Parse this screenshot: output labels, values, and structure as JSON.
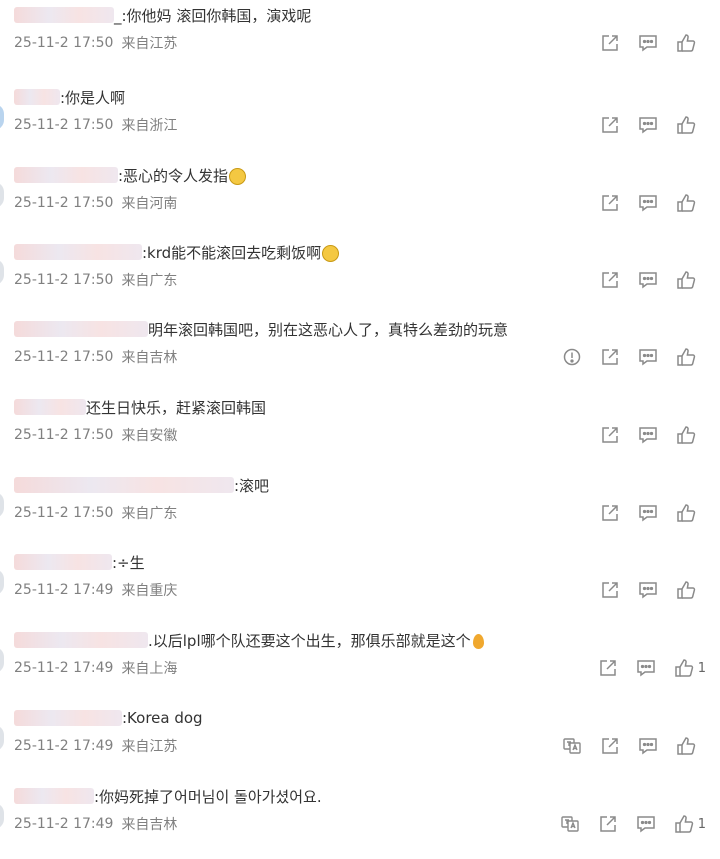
{
  "colors": {
    "text": "#333333",
    "meta": "#808080",
    "icon": "#8a8a8a"
  },
  "comments": [
    {
      "text": "_:你他妈 滚回你韩国，演戏呢",
      "date": "25-11-2 17:50",
      "location": "来自江苏",
      "like_count": ""
    },
    {
      "text": ":你是人啊",
      "date": "25-11-2 17:50",
      "location": "来自浙江",
      "like_count": ""
    },
    {
      "text": ":恶心的令人发指",
      "date": "25-11-2 17:50",
      "location": "来自河南",
      "like_count": ""
    },
    {
      "text": ":krd能不能滚回去吃剩饭啊",
      "date": "25-11-2 17:50",
      "location": "来自广东",
      "like_count": ""
    },
    {
      "text": "明年滚回韩国吧，别在这恶心人了，真特么差劲的玩意",
      "date": "25-11-2 17:50",
      "location": "来自吉林",
      "like_count": ""
    },
    {
      "text": "还生日快乐，赶紧滚回韩国",
      "date": "25-11-2 17:50",
      "location": "来自安徽",
      "like_count": ""
    },
    {
      "text": ":滚吧",
      "date": "25-11-2 17:50",
      "location": "来自广东",
      "like_count": ""
    },
    {
      "text": ":÷生",
      "date": "25-11-2 17:49",
      "location": "来自重庆",
      "like_count": ""
    },
    {
      "text": ".以后lpl哪个队还要这个出生，那俱乐部就是这个",
      "date": "25-11-2 17:49",
      "location": "来自上海",
      "like_count": "1"
    },
    {
      "text": ":Korea dog",
      "date": "25-11-2 17:49",
      "location": "来自江苏",
      "like_count": ""
    },
    {
      "text": ":你妈死掉了어머님이 돌아가셨어요.",
      "date": "25-11-2 17:49",
      "location": "来自吉林",
      "like_count": "1"
    }
  ]
}
